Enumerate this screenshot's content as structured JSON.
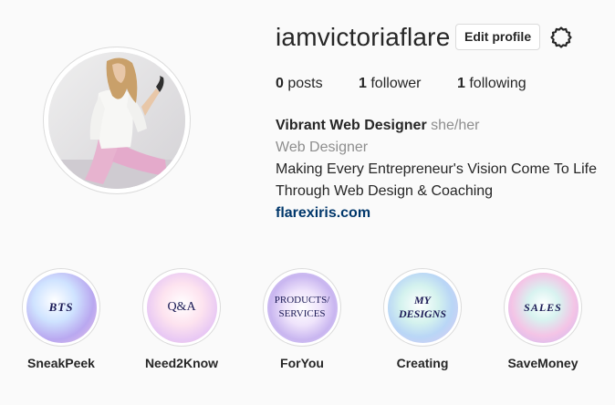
{
  "profile": {
    "username": "iamvictoriaflare",
    "edit_label": "Edit profile"
  },
  "stats": {
    "posts_count": "0",
    "posts_label": "posts",
    "followers_count": "1",
    "followers_label": "follower",
    "following_count": "1",
    "following_label": "following"
  },
  "bio": {
    "name": "Vibrant Web Designer",
    "pronouns": "she/her",
    "category": "Web Designer",
    "line1": "Making Every Entrepreneur's Vision Come To Life",
    "line2": "Through Web Design & Coaching",
    "link": "flarexiris.com"
  },
  "highlights": [
    {
      "cover_text": "BTS",
      "label": "SneakPeek"
    },
    {
      "cover_text": "Q&A",
      "label": "Need2Know"
    },
    {
      "cover_text_line1": "PRODUCTS/",
      "cover_text_line2": "SERVICES",
      "label": "ForYou"
    },
    {
      "cover_text_line1": "MY",
      "cover_text_line2": "DESIGNS",
      "label": "Creating"
    },
    {
      "cover_text": "SALES",
      "label": "SaveMoney"
    }
  ],
  "colors": {
    "background": "#fafafa",
    "text": "#262626",
    "muted": "#8e8e8e",
    "link": "#00376b",
    "border": "#dbdbdb"
  },
  "icons": {
    "settings": "gear-icon"
  }
}
